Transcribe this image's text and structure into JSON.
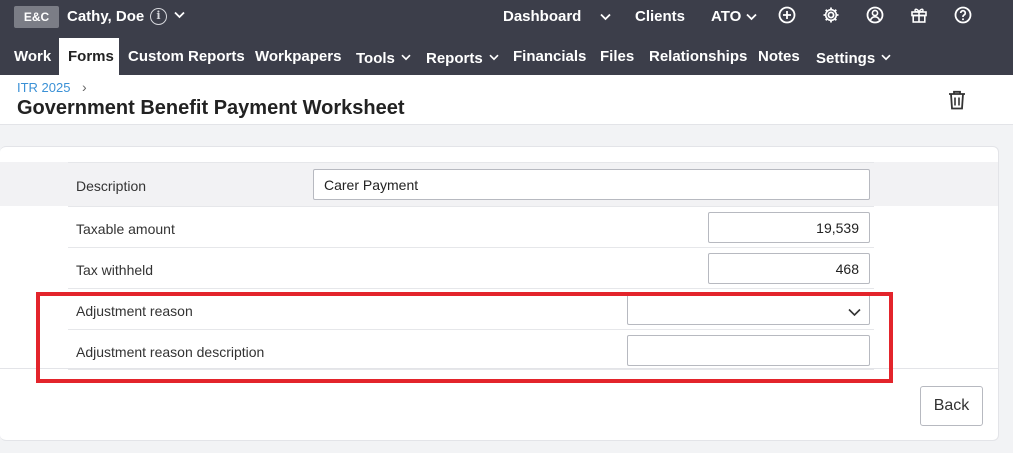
{
  "app": {
    "logo": "E&C",
    "client_name": "Cathy, Doe",
    "info_icon": "info-icon"
  },
  "top_links": {
    "dashboard": "Dashboard",
    "clients": "Clients",
    "ato": "ATO"
  },
  "top_icons": [
    "plus-circle-icon",
    "gear-icon",
    "user-icon",
    "gift-icon",
    "help-icon"
  ],
  "nav": {
    "items": [
      {
        "label": "Work",
        "dropdown": false,
        "active": false
      },
      {
        "label": "Forms",
        "dropdown": false,
        "active": true
      },
      {
        "label": "Custom Reports",
        "dropdown": false,
        "active": false
      },
      {
        "label": "Workpapers",
        "dropdown": false,
        "active": false
      },
      {
        "label": "Tools",
        "dropdown": true,
        "active": false
      },
      {
        "label": "Reports",
        "dropdown": true,
        "active": false
      },
      {
        "label": "Financials",
        "dropdown": false,
        "active": false
      },
      {
        "label": "Files",
        "dropdown": false,
        "active": false
      },
      {
        "label": "Relationships",
        "dropdown": false,
        "active": false
      },
      {
        "label": "Notes",
        "dropdown": false,
        "active": false
      },
      {
        "label": "Settings",
        "dropdown": true,
        "active": false
      }
    ]
  },
  "breadcrumb": {
    "parent": "ITR 2025",
    "separator": "›"
  },
  "page": {
    "title": "Government Benefit Payment Worksheet",
    "delete_icon": "trash-icon"
  },
  "form": {
    "description": {
      "label": "Description",
      "value": "Carer Payment"
    },
    "taxable_amount": {
      "label": "Taxable amount",
      "value": "19,539"
    },
    "tax_withheld": {
      "label": "Tax withheld",
      "value": "468"
    },
    "adjustment_reason": {
      "label": "Adjustment reason",
      "value": ""
    },
    "adjustment_reason_description": {
      "label": "Adjustment reason description",
      "value": ""
    }
  },
  "actions": {
    "back": "Back"
  },
  "colors": {
    "topbar": "#3c3e4a",
    "link": "#3b91d6",
    "highlight": "#e3242b"
  }
}
